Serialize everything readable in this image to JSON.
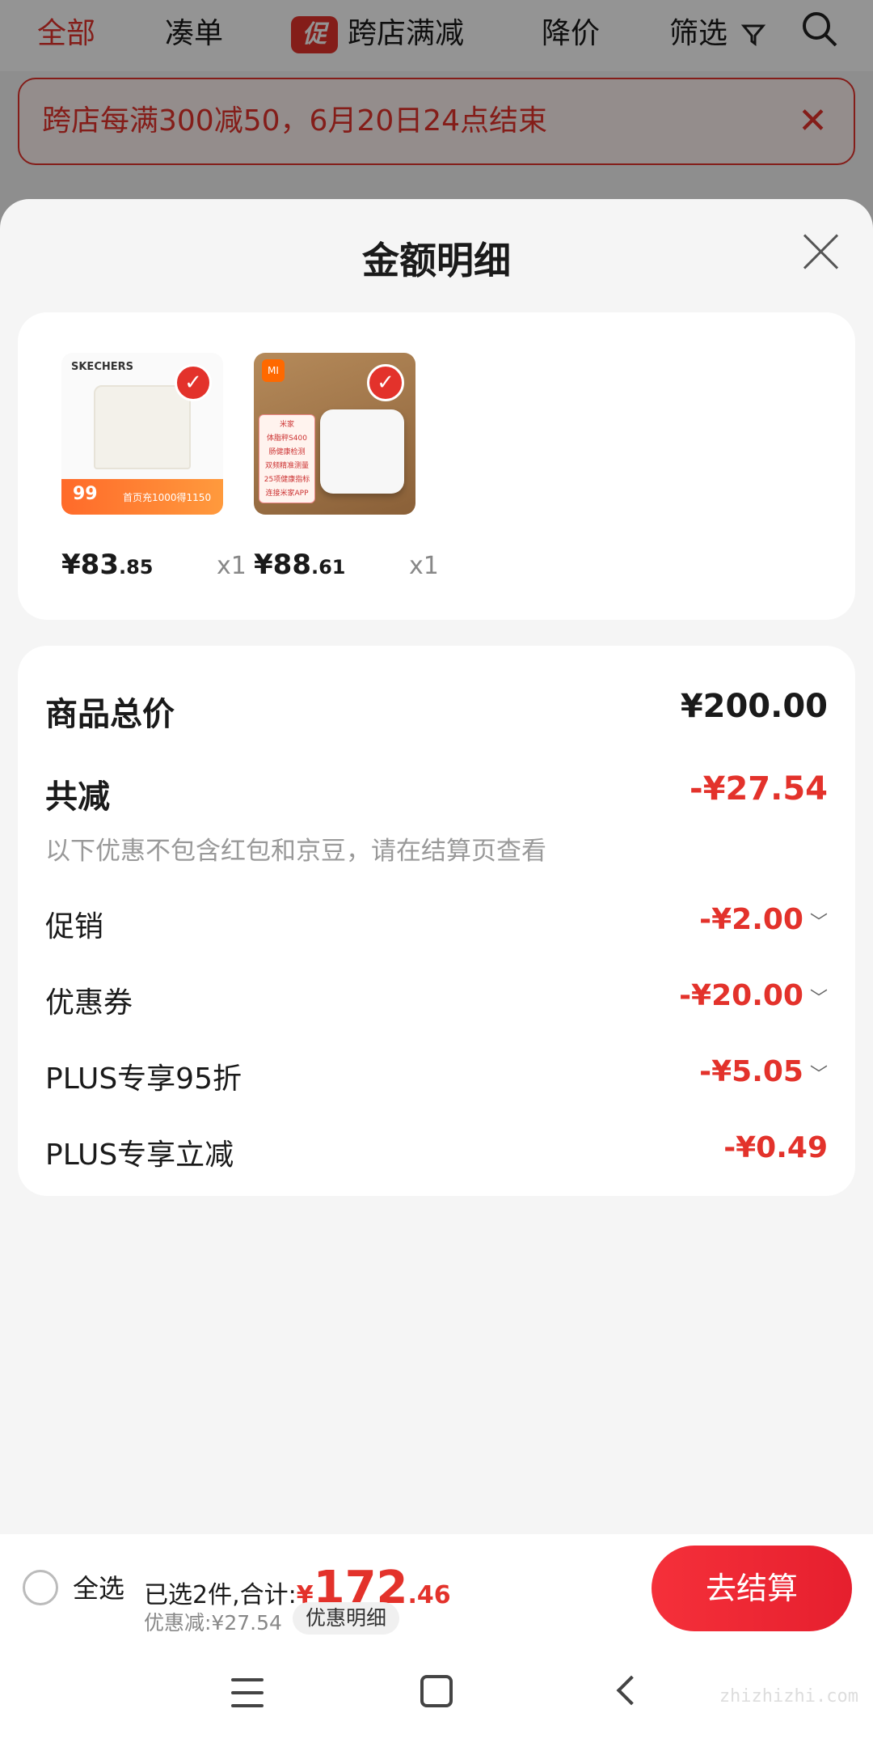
{
  "topbar": {
    "tabs": [
      "全部",
      "凑单",
      "跨店满减",
      "降价",
      "筛选"
    ],
    "promo_badge": "促"
  },
  "banner": {
    "text": "跨店每满300减50，6月20日24点结束"
  },
  "sheet": {
    "title": "金额明细"
  },
  "products": [
    {
      "brand": "SKECHERS",
      "badge": "99",
      "strip_text": "首页充1000得1150",
      "price_int": "¥83",
      "price_dec": ".85",
      "qty": "x1"
    },
    {
      "brand": "MI",
      "panel_lines": [
        "米家",
        "体脂秤S400",
        "肠健康检测",
        "双频精准测量",
        "25项健康指标",
        "连接米家APP"
      ],
      "price_int": "¥88",
      "price_dec": ".61",
      "qty": "x1"
    }
  ],
  "detail": {
    "total_label": "商品总价",
    "total_value": "¥200.00",
    "reduce_label": "共减",
    "reduce_value": "-¥27.54",
    "note": "以下优惠不包含红包和京豆，请在结算页查看",
    "items": [
      {
        "label": "促销",
        "value": "-¥2.00",
        "expand": true
      },
      {
        "label": "优惠券",
        "value": "-¥20.00",
        "expand": true
      },
      {
        "label": "PLUS专享95折",
        "value": "-¥5.05",
        "expand": true
      },
      {
        "label": "PLUS专享立减",
        "value": "-¥0.49",
        "expand": false
      }
    ]
  },
  "bottombar": {
    "select_all": "全选",
    "summary_prefix": "已选2件,合计:",
    "currency": "¥",
    "total_int": "172",
    "total_dec": ".46",
    "discount": "优惠减:¥27.54",
    "detail_chip": "优惠明细",
    "checkout": "去结算"
  },
  "watermark": "zhizhizhi.com",
  "colors": {
    "accent": "#e3322b",
    "muted": "#999999"
  }
}
